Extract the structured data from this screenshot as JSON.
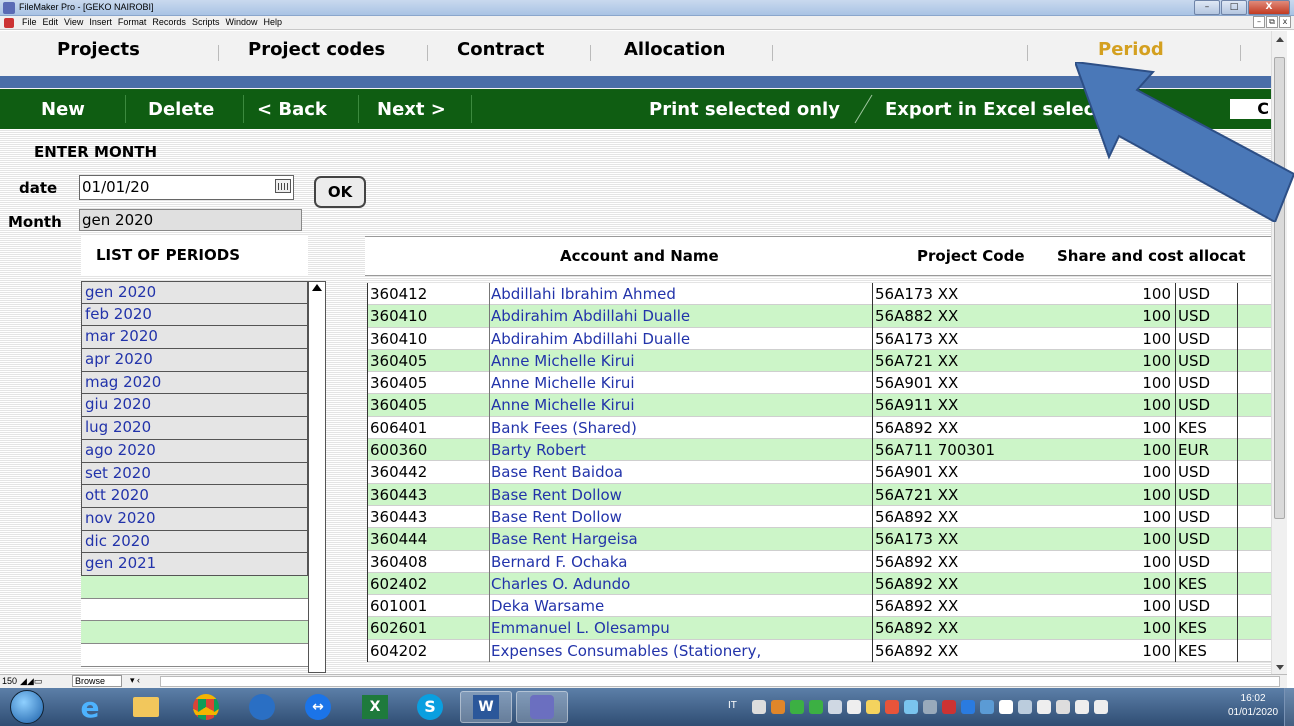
{
  "window": {
    "title": "FileMaker Pro - [GEKO NAIROBI]",
    "controls": [
      "–",
      "□",
      "X"
    ]
  },
  "menu": [
    "File",
    "Edit",
    "View",
    "Insert",
    "Format",
    "Records",
    "Scripts",
    "Window",
    "Help"
  ],
  "mdi_controls": [
    "–",
    "⧉",
    "x"
  ],
  "tabs": {
    "projects": "Projects",
    "project_codes": "Project codes",
    "contract": "Contract",
    "allocation": "Allocation",
    "period": "Period",
    "active": "period",
    "active_color": "#d4a020"
  },
  "toolbar": {
    "new": "New",
    "delete": "Delete",
    "back": "< Back",
    "next": "Next >",
    "print": "Print selected only",
    "export": "Export in Excel selecte",
    "box_text": "C",
    "color": "#0f5d12"
  },
  "form": {
    "enter_month": "ENTER MONTH",
    "date_label": "date",
    "date_value": "01/01/20",
    "ok": "OK",
    "month_label": "Month",
    "month_value": "gen 2020"
  },
  "periods": {
    "title": "LIST OF PERIODS",
    "items": [
      "gen 2020",
      "feb 2020",
      "mar 2020",
      "apr 2020",
      "mag 2020",
      "giu 2020",
      "lug 2020",
      "ago 2020",
      "set 2020",
      "ott 2020",
      "nov 2020",
      "dic 2020",
      "gen 2021"
    ]
  },
  "table": {
    "headers": {
      "account_name": "Account and Name",
      "project_code": "Project Code",
      "share": "Share and cost allocat"
    },
    "rows": [
      {
        "account": "360412",
        "name": "Abdillahi Ibrahim Ahmed",
        "project": "56A173 XX",
        "share": "100",
        "currency": "USD"
      },
      {
        "account": "360410",
        "name": "Abdirahim Abdillahi Dualle",
        "project": "56A882 XX",
        "share": "100",
        "currency": "USD"
      },
      {
        "account": "360410",
        "name": "Abdirahim Abdillahi Dualle",
        "project": "56A173 XX",
        "share": "100",
        "currency": "USD"
      },
      {
        "account": "360405",
        "name": "Anne Michelle Kirui",
        "project": "56A721 XX",
        "share": "100",
        "currency": "USD"
      },
      {
        "account": "360405",
        "name": "Anne Michelle Kirui",
        "project": "56A901 XX",
        "share": "100",
        "currency": "USD"
      },
      {
        "account": "360405",
        "name": "Anne Michelle Kirui",
        "project": "56A911 XX",
        "share": "100",
        "currency": "USD"
      },
      {
        "account": "606401",
        "name": "Bank Fees (Shared)",
        "project": "56A892 XX",
        "share": "100",
        "currency": "KES"
      },
      {
        "account": "600360",
        "name": "Barty Robert",
        "project": "56A711 700301",
        "share": "100",
        "currency": "EUR"
      },
      {
        "account": "360442",
        "name": "Base Rent Baidoa",
        "project": "56A901 XX",
        "share": "100",
        "currency": "USD"
      },
      {
        "account": "360443",
        "name": "Base Rent Dollow",
        "project": "56A721 XX",
        "share": "100",
        "currency": "USD"
      },
      {
        "account": "360443",
        "name": "Base Rent Dollow",
        "project": "56A892 XX",
        "share": "100",
        "currency": "USD"
      },
      {
        "account": "360444",
        "name": "Base Rent Hargeisa",
        "project": "56A173 XX",
        "share": "100",
        "currency": "USD"
      },
      {
        "account": "360408",
        "name": "Bernard F. Ochaka",
        "project": "56A892 XX",
        "share": "100",
        "currency": "USD"
      },
      {
        "account": "602402",
        "name": "Charles O. Adundo",
        "project": "56A892 XX",
        "share": "100",
        "currency": "KES"
      },
      {
        "account": "601001",
        "name": "Deka Warsame",
        "project": "56A892 XX",
        "share": "100",
        "currency": "USD"
      },
      {
        "account": "602601",
        "name": "Emmanuel L. Olesampu",
        "project": "56A892 XX",
        "share": "100",
        "currency": "KES"
      },
      {
        "account": "604202",
        "name": "Expenses Consumables (Stationery,",
        "project": "56A892 XX",
        "share": "100",
        "currency": "KES"
      }
    ],
    "row_colors": {
      "even": "#ffffff",
      "odd": "#ccf5c8"
    }
  },
  "statusbar": {
    "zoom": "150",
    "mode": "Browse"
  },
  "taskbar": {
    "apps": [
      "ie-icon",
      "explorer-icon",
      "chrome-icon",
      "thunderbird-icon",
      "teamviewer-icon",
      "excel-icon",
      "skype-icon",
      "word-icon",
      "filemaker-icon"
    ],
    "lang": "IT",
    "time": "16:02",
    "date": "01/01/2020"
  },
  "annotation": {
    "arrow_color": "#4a78b8"
  }
}
